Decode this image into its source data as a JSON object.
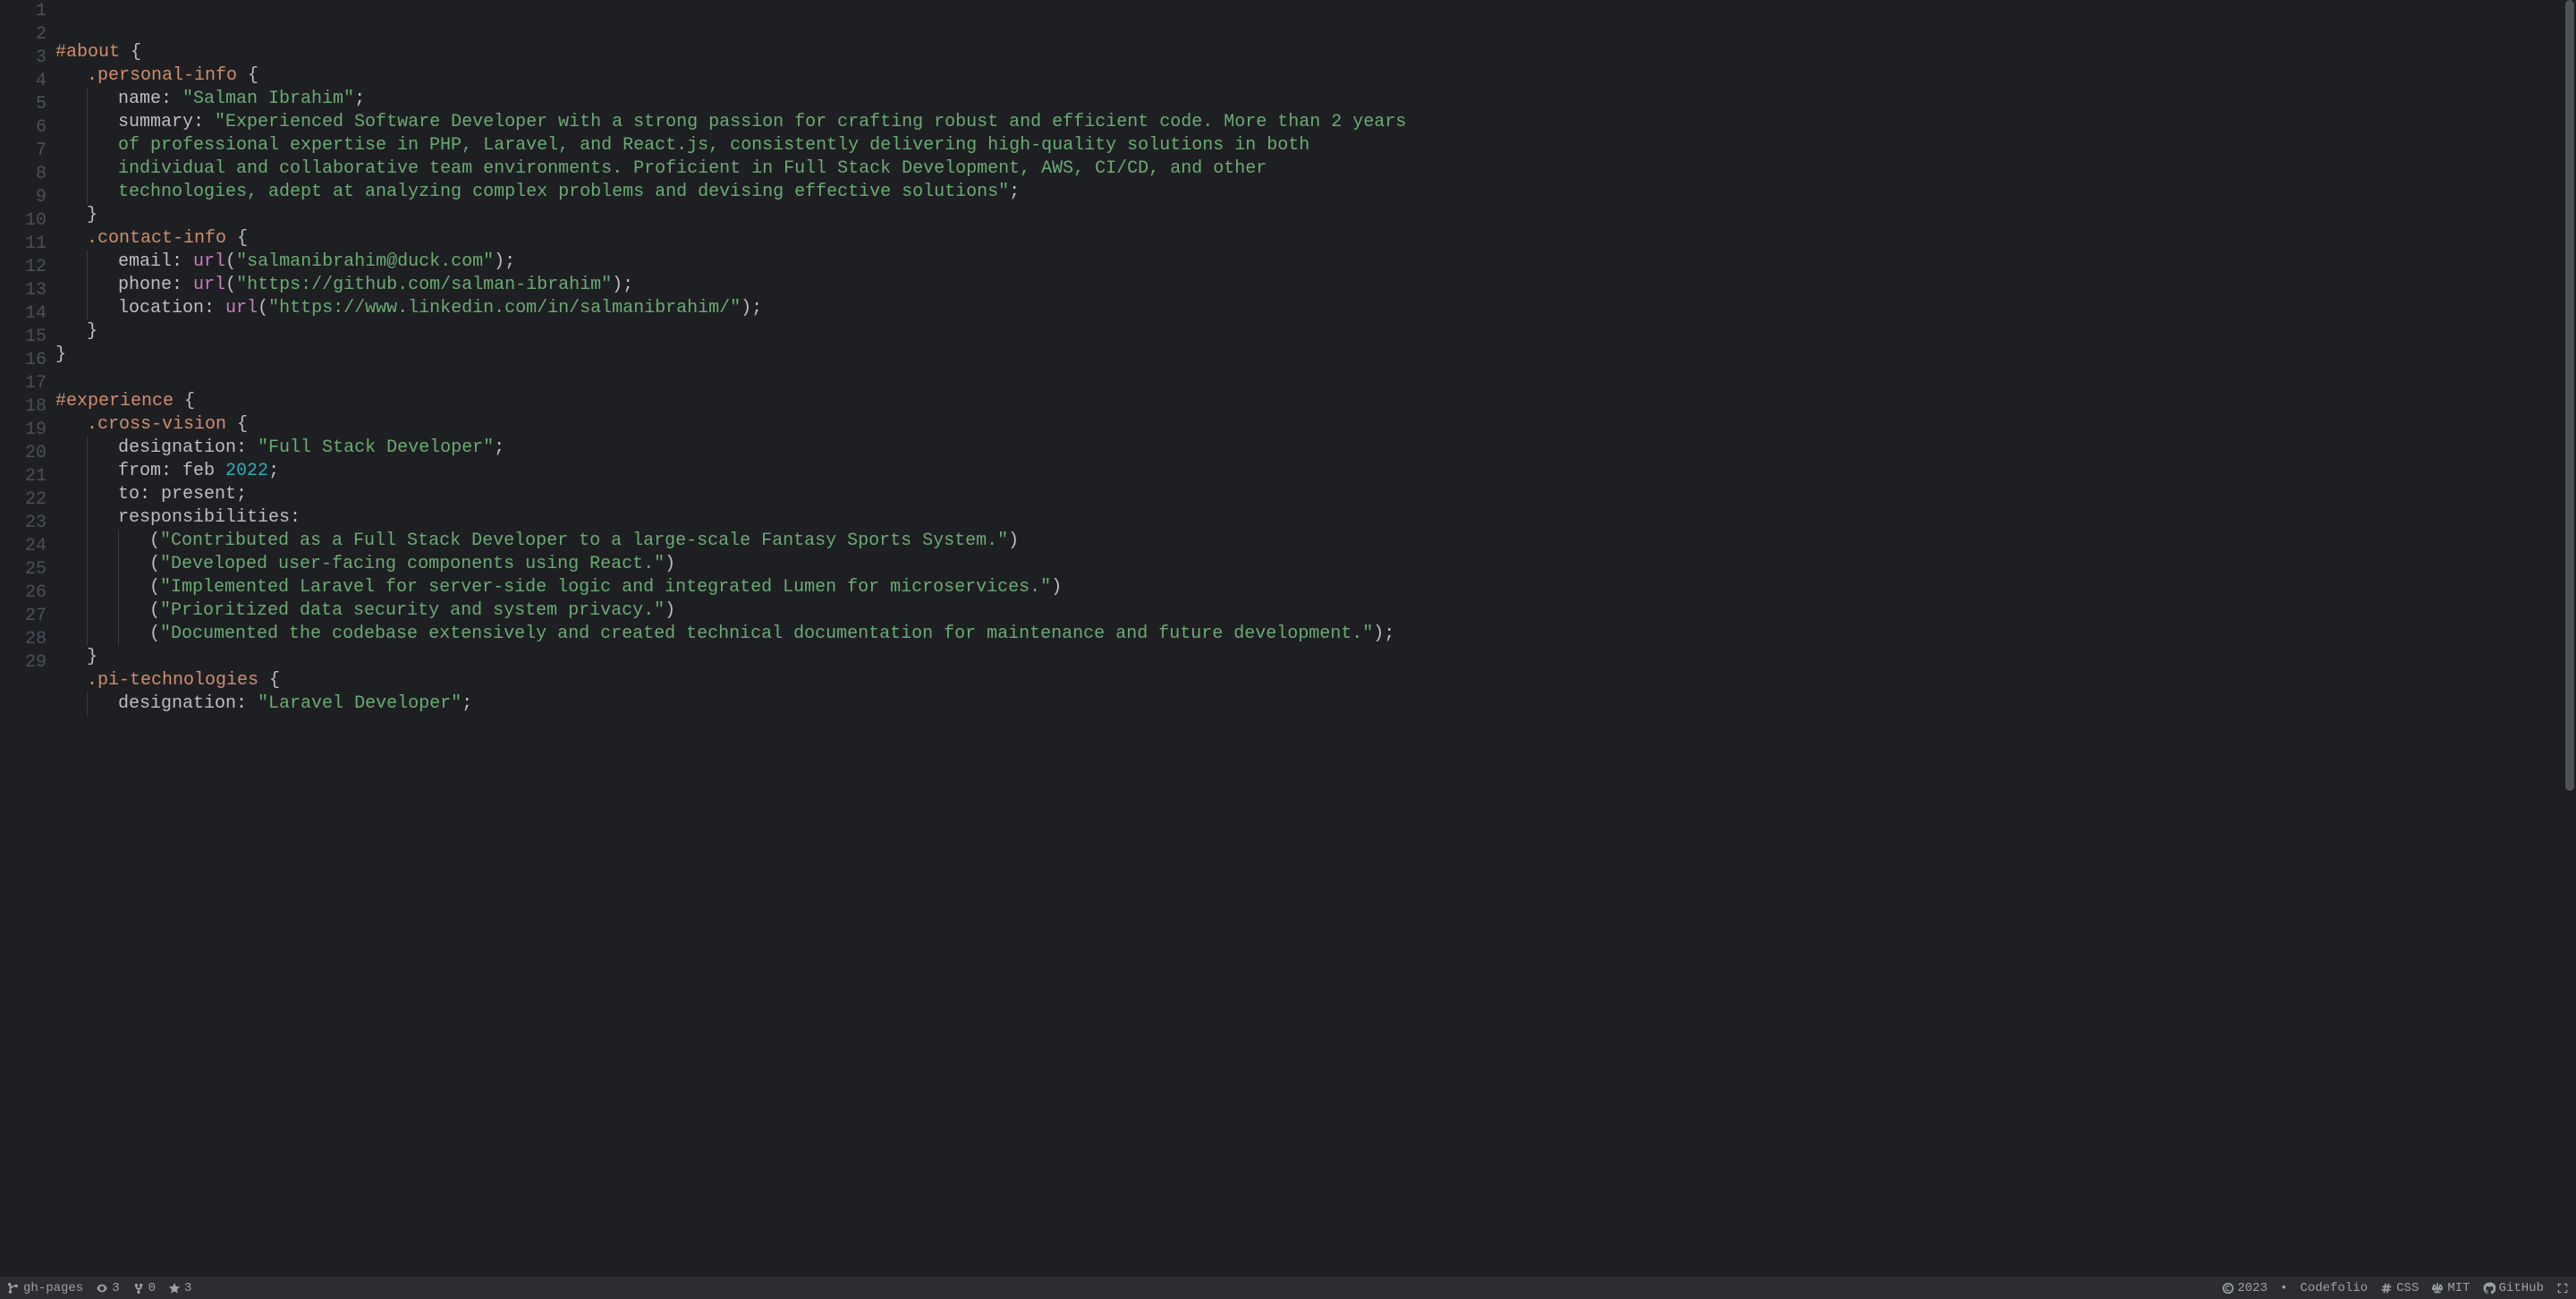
{
  "lines": [
    {
      "indent": 0,
      "tokens": [
        {
          "t": "selector",
          "v": "#about"
        },
        {
          "t": "punct",
          "v": " "
        },
        {
          "t": "brace",
          "v": "{"
        }
      ]
    },
    {
      "indent": 1,
      "tokens": [
        {
          "t": "selector",
          "v": ".personal-info"
        },
        {
          "t": "punct",
          "v": " "
        },
        {
          "t": "brace",
          "v": "{"
        }
      ]
    },
    {
      "indent": 2,
      "tokens": [
        {
          "t": "prop",
          "v": "name"
        },
        {
          "t": "punct",
          "v": ": "
        },
        {
          "t": "string",
          "v": "\"Salman Ibrahim\""
        },
        {
          "t": "punct",
          "v": ";"
        }
      ]
    },
    {
      "indent": 2,
      "tokens": [
        {
          "t": "prop",
          "v": "summary"
        },
        {
          "t": "punct",
          "v": ": "
        },
        {
          "t": "string",
          "v": "\"Experienced Software Developer with a strong passion for crafting robust and efficient code. More than 2 years"
        }
      ]
    },
    {
      "indent": 2,
      "tokens": [
        {
          "t": "string",
          "v": "of professional expertise in PHP, Laravel, and React.js, consistently delivering high-quality solutions in both"
        }
      ]
    },
    {
      "indent": 2,
      "tokens": [
        {
          "t": "string",
          "v": "individual and collaborative team environments. Proficient in Full Stack Development, AWS, CI/CD, and other"
        }
      ]
    },
    {
      "indent": 2,
      "tokens": [
        {
          "t": "string",
          "v": "technologies, adept at analyzing complex problems and devising effective solutions\""
        },
        {
          "t": "punct",
          "v": ";"
        }
      ]
    },
    {
      "indent": 1,
      "tokens": [
        {
          "t": "brace",
          "v": "}"
        }
      ]
    },
    {
      "indent": 1,
      "tokens": [
        {
          "t": "selector",
          "v": ".contact-info"
        },
        {
          "t": "punct",
          "v": " "
        },
        {
          "t": "brace",
          "v": "{"
        }
      ]
    },
    {
      "indent": 2,
      "tokens": [
        {
          "t": "prop",
          "v": "email"
        },
        {
          "t": "punct",
          "v": ": "
        },
        {
          "t": "func",
          "v": "url"
        },
        {
          "t": "punct",
          "v": "("
        },
        {
          "t": "string",
          "v": "\"salmanibrahim@duck.com\""
        },
        {
          "t": "punct",
          "v": ");"
        }
      ]
    },
    {
      "indent": 2,
      "tokens": [
        {
          "t": "prop",
          "v": "phone"
        },
        {
          "t": "punct",
          "v": ": "
        },
        {
          "t": "func",
          "v": "url"
        },
        {
          "t": "punct",
          "v": "("
        },
        {
          "t": "string",
          "v": "\"https://github.com/salman-ibrahim\""
        },
        {
          "t": "punct",
          "v": ");"
        }
      ]
    },
    {
      "indent": 2,
      "tokens": [
        {
          "t": "prop",
          "v": "location"
        },
        {
          "t": "punct",
          "v": ": "
        },
        {
          "t": "func",
          "v": "url"
        },
        {
          "t": "punct",
          "v": "("
        },
        {
          "t": "string",
          "v": "\"https://www.linkedin.com/in/salmanibrahim/\""
        },
        {
          "t": "punct",
          "v": ");"
        }
      ]
    },
    {
      "indent": 1,
      "tokens": [
        {
          "t": "brace",
          "v": "}"
        }
      ]
    },
    {
      "indent": 0,
      "tokens": [
        {
          "t": "brace",
          "v": "}"
        }
      ]
    },
    {
      "indent": 0,
      "tokens": []
    },
    {
      "indent": 0,
      "tokens": [
        {
          "t": "selector",
          "v": "#experience"
        },
        {
          "t": "punct",
          "v": " "
        },
        {
          "t": "brace",
          "v": "{"
        }
      ]
    },
    {
      "indent": 1,
      "tokens": [
        {
          "t": "selector",
          "v": ".cross-vision"
        },
        {
          "t": "punct",
          "v": " "
        },
        {
          "t": "brace",
          "v": "{"
        }
      ]
    },
    {
      "indent": 2,
      "tokens": [
        {
          "t": "prop",
          "v": "designation"
        },
        {
          "t": "punct",
          "v": ": "
        },
        {
          "t": "string",
          "v": "\"Full Stack Developer\""
        },
        {
          "t": "punct",
          "v": ";"
        }
      ]
    },
    {
      "indent": 2,
      "tokens": [
        {
          "t": "prop",
          "v": "from"
        },
        {
          "t": "punct",
          "v": ": "
        },
        {
          "t": "const",
          "v": "feb "
        },
        {
          "t": "num",
          "v": "2022"
        },
        {
          "t": "punct",
          "v": ";"
        }
      ]
    },
    {
      "indent": 2,
      "tokens": [
        {
          "t": "prop",
          "v": "to"
        },
        {
          "t": "punct",
          "v": ": "
        },
        {
          "t": "const",
          "v": "present"
        },
        {
          "t": "punct",
          "v": ";"
        }
      ]
    },
    {
      "indent": 2,
      "tokens": [
        {
          "t": "prop",
          "v": "responsibilities"
        },
        {
          "t": "punct",
          "v": ":"
        }
      ]
    },
    {
      "indent": 3,
      "tokens": [
        {
          "t": "punct",
          "v": "("
        },
        {
          "t": "string",
          "v": "\"Contributed as a Full Stack Developer to a large-scale Fantasy Sports System.\""
        },
        {
          "t": "punct",
          "v": ")"
        }
      ]
    },
    {
      "indent": 3,
      "tokens": [
        {
          "t": "punct",
          "v": "("
        },
        {
          "t": "string",
          "v": "\"Developed user-facing components using React.\""
        },
        {
          "t": "punct",
          "v": ")"
        }
      ]
    },
    {
      "indent": 3,
      "tokens": [
        {
          "t": "punct",
          "v": "("
        },
        {
          "t": "string",
          "v": "\"Implemented Laravel for server-side logic and integrated Lumen for microservices.\""
        },
        {
          "t": "punct",
          "v": ")"
        }
      ]
    },
    {
      "indent": 3,
      "tokens": [
        {
          "t": "punct",
          "v": "("
        },
        {
          "t": "string",
          "v": "\"Prioritized data security and system privacy.\""
        },
        {
          "t": "punct",
          "v": ")"
        }
      ]
    },
    {
      "indent": 3,
      "tokens": [
        {
          "t": "punct",
          "v": "("
        },
        {
          "t": "string",
          "v": "\"Documented the codebase extensively and created technical documentation for maintenance and future development.\""
        },
        {
          "t": "punct",
          "v": ");"
        }
      ]
    },
    {
      "indent": 1,
      "tokens": [
        {
          "t": "brace",
          "v": "}"
        }
      ]
    },
    {
      "indent": 1,
      "tokens": [
        {
          "t": "selector",
          "v": ".pi-technologies"
        },
        {
          "t": "punct",
          "v": " "
        },
        {
          "t": "brace",
          "v": "{"
        }
      ]
    },
    {
      "indent": 2,
      "tokens": [
        {
          "t": "prop",
          "v": "designation"
        },
        {
          "t": "punct",
          "v": ": "
        },
        {
          "t": "string",
          "v": "\"Laravel Developer\""
        },
        {
          "t": "punct",
          "v": ";"
        }
      ]
    }
  ],
  "status": {
    "branch": "gh-pages",
    "watchers": "3",
    "forks": "0",
    "stars": "3",
    "copyright": "2023",
    "bullet": "•",
    "sitename": "Codefolio",
    "language": "CSS",
    "license": "MIT",
    "repo": "GitHub"
  }
}
